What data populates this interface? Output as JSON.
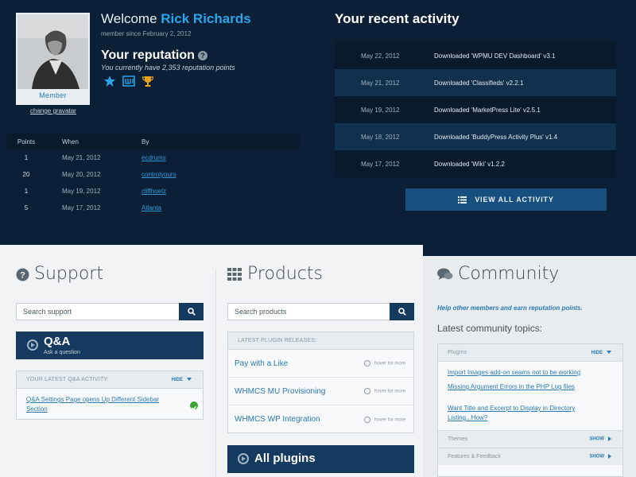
{
  "profile": {
    "welcome_prefix": "Welcome",
    "name": "Rick Richards",
    "member_since": "member since February 2, 2012",
    "role_label": "Member",
    "change_gravatar": "change gravatar"
  },
  "reputation": {
    "title": "Your reputation",
    "points_text": "You currently have 2,353 reputation points",
    "badges": [
      "star-icon",
      "wpmu-dev-icon",
      "trophy-icon"
    ],
    "table": {
      "headers": [
        "Points",
        "When",
        "By"
      ],
      "rows": [
        {
          "points": "1",
          "when": "May 21, 2012",
          "by": "ecdrums"
        },
        {
          "points": "20",
          "when": "May 20, 2012",
          "by": "controlyours"
        },
        {
          "points": "1",
          "when": "May 19, 2012",
          "by": "cliffhoelz"
        },
        {
          "points": "5",
          "when": "May 17, 2012",
          "by": "Atlanta"
        }
      ]
    }
  },
  "activity": {
    "title": "Your recent activity",
    "items": [
      {
        "date": "May 22, 2012",
        "text": "Downloaded 'WPMU DEV Dashboard' v3.1"
      },
      {
        "date": "May 21, 2012",
        "text": "Downloaded 'Classifieds' v2.2.1"
      },
      {
        "date": "May 19, 2012",
        "text": "Downloaded 'MarketPress Lite' v2.5.1"
      },
      {
        "date": "May 18, 2012",
        "text": "Downloaded 'BuddyPress Activity Plus' v1.4"
      },
      {
        "date": "May 17, 2012",
        "text": "Downloaded 'Wiki' v1.2.2"
      }
    ],
    "view_all_label": "VIEW ALL ACTIVITY"
  },
  "support": {
    "title": "Support",
    "search_placeholder": "Search support",
    "qa_title": "Q&A",
    "qa_sub": "Ask a question",
    "latest_head": "YOUR LATEST Q&A ACTIVITY:",
    "hide_label": "HIDE",
    "latest_item": "Q&A Settings Page opens Up Different Sidebar Section"
  },
  "products": {
    "title": "Products",
    "search_placeholder": "Search products",
    "latest_head": "LATEST PLUGIN RELEASES:",
    "plugins": [
      "Pay with a Like",
      "WHMCS MU Provisioning",
      "WHMCS WP Integration"
    ],
    "hover_label": "hover for more",
    "all_plugins_label": "All plugins"
  },
  "community": {
    "title": "Community",
    "tagline": "Help other members and earn reputation points.",
    "latest_label": "Latest community topics:",
    "plugins_head": "Plugins",
    "hide_label": "HIDE",
    "topics": [
      "Import Images add-on seams not to be working",
      "Missing Argument Errors in the PHP Log files",
      "Want Title and Excerpt to Display in Directory Listing...How?"
    ],
    "groups": [
      {
        "label": "Themes",
        "action": "SHOW"
      },
      {
        "label": "Features & Feedback",
        "action": "SHOW"
      }
    ]
  },
  "colors": {
    "dark_bg": "#0b2036",
    "accent_blue": "#2aa6e8",
    "button_navy": "#143a60",
    "link_blue": "#2a7ab4"
  }
}
